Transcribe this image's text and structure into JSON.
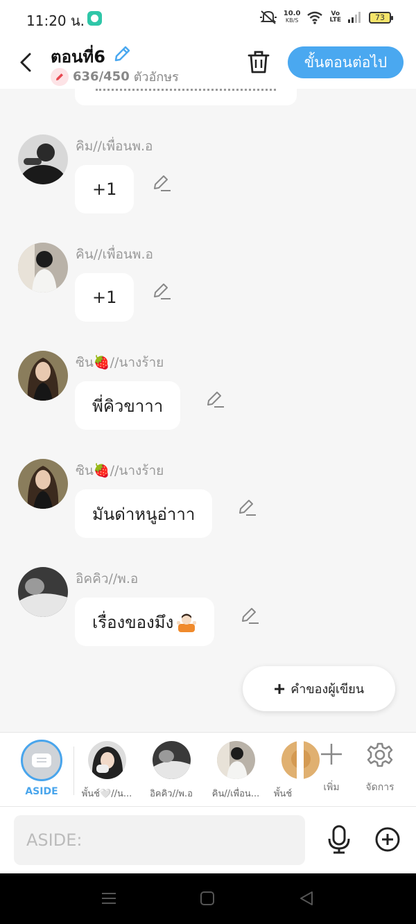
{
  "status_bar": {
    "time": "11:20 น.",
    "net_speed_value": "10.0",
    "net_speed_unit": "KB/S",
    "volte_top": "Vo",
    "volte_bottom": "LTE",
    "battery": "73"
  },
  "header": {
    "title": "ตอนที่6",
    "char_count": "636/450",
    "char_unit": "ตัวอักษร",
    "next_button": "ขั้นตอนต่อไป"
  },
  "messages": [
    {
      "sender": "คิม//เพื่อนพ.อ",
      "text": "+1"
    },
    {
      "sender": "คิน//เพื่อนพ.อ",
      "text": "+1"
    },
    {
      "sender": "ซิน",
      "sender_emoji": "🍓",
      "sender_suffix": "//นางร้าย",
      "text": "พี่คิวขาาา"
    },
    {
      "sender": "ซิน",
      "sender_emoji": "🍓",
      "sender_suffix": "//นางร้าย",
      "text": "มันด่าหนูอ่าาา"
    },
    {
      "sender": "อิคคิว//พ.อ",
      "text": "เรื่องของมึง"
    }
  ],
  "author_button": "คำของผู้เขียน",
  "character_bar": {
    "aside_label": "ASIDE",
    "characters": [
      {
        "name": "พั้นช์🤍//น..."
      },
      {
        "name": "อิคคิว//พ.อ"
      },
      {
        "name": "คิน//เพื่อน..."
      },
      {
        "name": "พั้นช์"
      }
    ],
    "add_label": "เพิ่ม",
    "manage_label": "จัดการ"
  },
  "input": {
    "placeholder": "ASIDE:"
  },
  "colors": {
    "accent": "#4aa8f0",
    "chat_background": "#f6f6f6"
  }
}
